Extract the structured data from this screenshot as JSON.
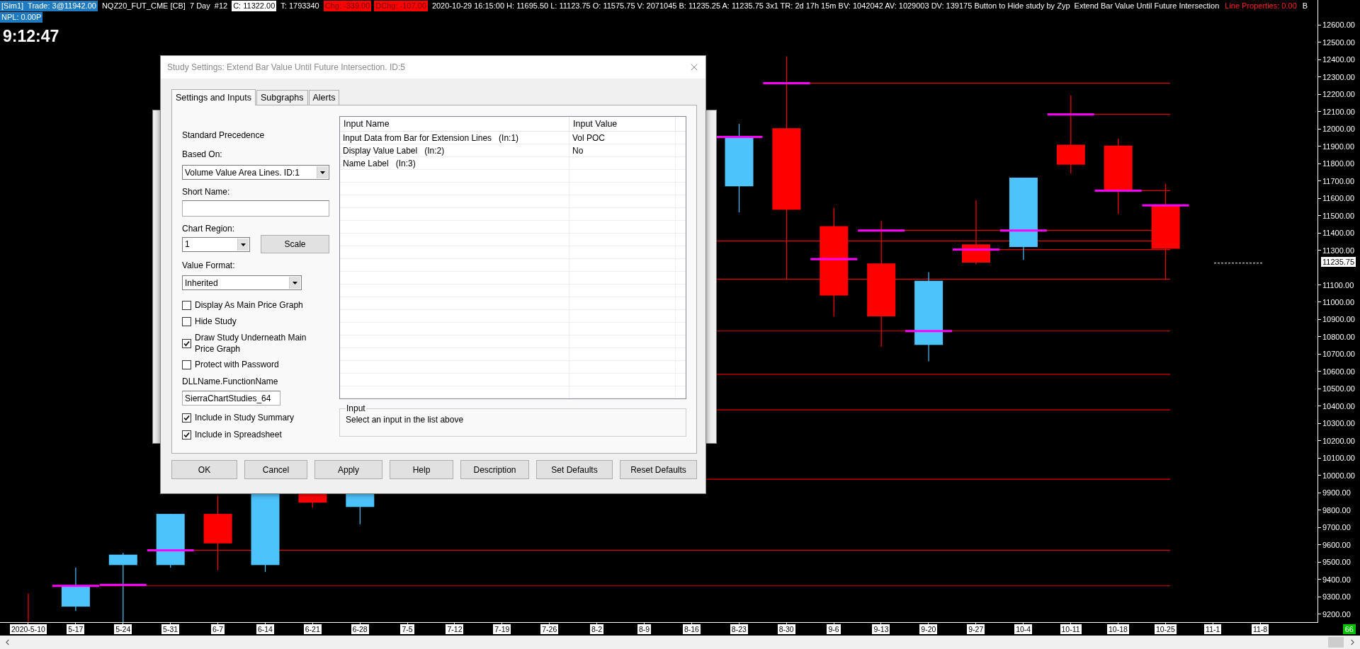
{
  "header": {
    "segments": [
      {
        "text": "[Sim1]  Trade: 3@11942.00",
        "kind": "account"
      },
      {
        "text": "NQZ20_FUT_CME [CB]  7 Day  #12",
        "kind": "plain"
      },
      {
        "text": "C: 11322.00",
        "kind": "inverse"
      },
      {
        "text": "T: 1793340",
        "kind": "plain"
      },
      {
        "text": "Chg: -339.00",
        "kind": "alert"
      },
      {
        "text": "DChg: -107.00",
        "kind": "alert"
      },
      {
        "text": "2020-10-29 16:15:00 H: 11695.50 L: 11123.75 O: 11575.75 V: 2071045 B: 11235.25 A: 11235.75 3x1 TR: 2d 17h 15m BV: 1042042 AV: 1029003 DV: 139175 Button to Hide study by Zyp  Extend Bar Value Until Future Intersection",
        "kind": "plain"
      },
      {
        "text": "Line Properties: 0.00",
        "kind": "warning"
      },
      {
        "text": "B",
        "kind": "plain"
      }
    ],
    "second_line": {
      "text": "NPL: 0.00P",
      "kind": "account"
    }
  },
  "clock": "9:12:47",
  "price_axis": {
    "labels_upper": [
      "12600.00",
      "12500.00",
      "12400.00",
      "12300.00",
      "12200.00",
      "12100.00",
      "12000.00",
      "11900.00",
      "11800.00",
      "11700.00",
      "11600.00",
      "11500.00",
      "11400.00",
      "11300.00"
    ],
    "labels_lower": [
      "11100.00",
      "11000.00",
      "10900.00",
      "10800.00",
      "10700.00",
      "10600.00",
      "10500.00",
      "10400.00",
      "10300.00",
      "10200.00",
      "10100.00",
      "10000.00",
      "9900.00",
      "9800.00",
      "9700.00",
      "9600.00",
      "9500.00",
      "9400.00",
      "9300.00",
      "9200.00"
    ],
    "current_price": "11235.75"
  },
  "date_axis": {
    "labels": [
      "2020-5-10",
      "5-17",
      "5-24",
      "5-31",
      "6-7",
      "6-14",
      "6-21",
      "6-28",
      "7-5",
      "7-12",
      "7-19",
      "7-26",
      "8-2",
      "8-9",
      "8-16",
      "8-23",
      "8-30",
      "9-6",
      "9-13",
      "9-20",
      "9-27",
      "10-4",
      "10-11",
      "10-18",
      "10-25",
      "11-1",
      "11-8"
    ]
  },
  "status_badge": "66",
  "dialog": {
    "title": "Study Settings: Extend Bar Value Until Future Intersection. ID:5",
    "tabs": [
      {
        "label": "Settings and Inputs",
        "selected": true
      },
      {
        "label": "Subgraphs",
        "selected": false
      },
      {
        "label": "Alerts",
        "selected": false
      }
    ],
    "precedence": "Standard Precedence",
    "based_on": {
      "label": "Based On:",
      "value": "Volume Value Area Lines. ID:1"
    },
    "short_name": {
      "label": "Short Name:"
    },
    "chart_region": {
      "label": "Chart Region:",
      "value": "1"
    },
    "scale_button": "Scale",
    "value_format": {
      "label": "Value Format:",
      "value": "Inherited"
    },
    "options": [
      {
        "label": "Display As Main Price Graph",
        "checked": false
      },
      {
        "label": "Hide Study",
        "checked": false
      },
      {
        "label": "Draw Study Underneath Main Price Graph",
        "checked": true
      },
      {
        "label": "Protect with Password",
        "checked": false
      }
    ],
    "dll": {
      "label": "DLLName.FunctionName",
      "value": "SierraChartStudies_64"
    },
    "options_2": [
      {
        "label": "Include in Study Summary",
        "checked": true
      },
      {
        "label": "Include in Spreadsheet",
        "checked": true
      }
    ],
    "inputs": {
      "columns": [
        "Input Name",
        "Input Value"
      ],
      "rows": [
        {
          "name": "Input Data from Bar for Extension Lines   (In:1)",
          "value": "Vol POC"
        },
        {
          "name": "Display Value Label   (In:2)",
          "value": "No"
        },
        {
          "name": "Name Label   (In:3)"
        }
      ]
    },
    "input_group": {
      "title": "Input",
      "text": "Select an input in the list above"
    },
    "buttons": [
      "OK",
      "Cancel",
      "Apply",
      "Help",
      "Description",
      "Set Defaults",
      "Reset Defaults"
    ]
  }
}
